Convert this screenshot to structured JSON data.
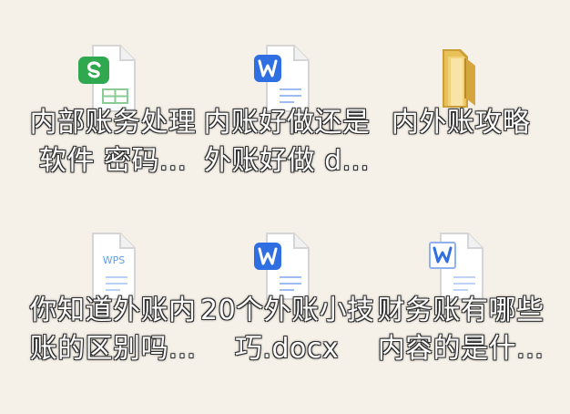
{
  "desktop": {
    "items": [
      {
        "icon": "spreadsheet-file-icon",
        "lines": [
          "内部账务处理",
          "软件 密码..."
        ]
      },
      {
        "icon": "word-document-icon",
        "lines": [
          "内账好做还是",
          "外账好做 d..."
        ]
      },
      {
        "icon": "folder-icon",
        "lines": [
          "内外账攻略"
        ]
      },
      {
        "icon": "wps-document-icon",
        "lines": [
          "你知道外账内",
          "账的区别吗..."
        ]
      },
      {
        "icon": "word-document-icon",
        "lines": [
          "20个外账小技",
          "巧.docx"
        ]
      },
      {
        "icon": "word-document-icon",
        "lines": [
          "财务账有哪些",
          "内容的是什..."
        ]
      }
    ]
  },
  "colors": {
    "background": "#f6f1e8",
    "spreadsheet_green": "#2fa84f",
    "word_blue": "#2f6fe2",
    "wps_blue": "#5a9ff0",
    "folder_yellow": "#e8c15a"
  }
}
